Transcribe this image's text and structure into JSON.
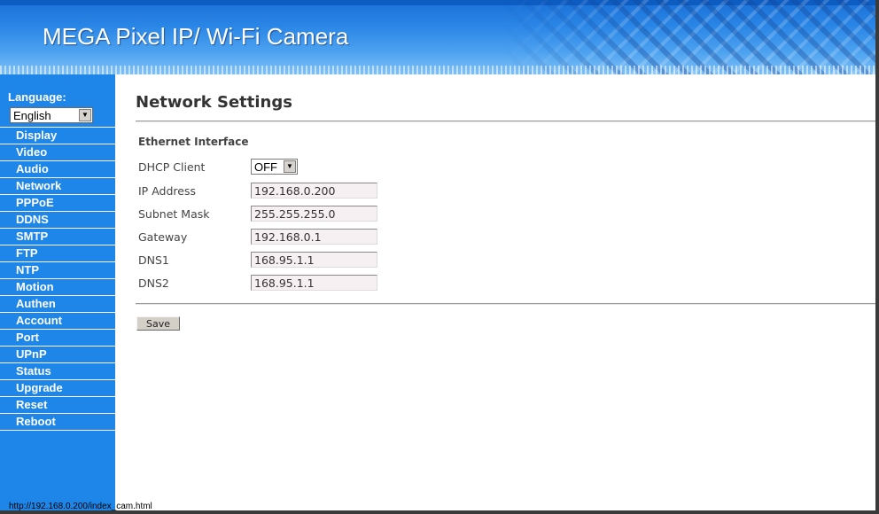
{
  "header": {
    "title": "MEGA Pixel IP/ Wi-Fi Camera"
  },
  "sidebar": {
    "language_label": "Language:",
    "language_value": "English",
    "menu": [
      {
        "label": "Display"
      },
      {
        "label": "Video"
      },
      {
        "label": "Audio"
      },
      {
        "label": "Network"
      },
      {
        "label": "PPPoE"
      },
      {
        "label": "DDNS"
      },
      {
        "label": "SMTP"
      },
      {
        "label": "FTP"
      },
      {
        "label": "NTP"
      },
      {
        "label": "Motion"
      },
      {
        "label": "Authen"
      },
      {
        "label": "Account"
      },
      {
        "label": "Port"
      },
      {
        "label": "UPnP"
      },
      {
        "label": "Status"
      },
      {
        "label": "Upgrade"
      },
      {
        "label": "Reset"
      },
      {
        "label": "Reboot"
      }
    ]
  },
  "main": {
    "page_title": "Network Settings",
    "section_title": "Ethernet Interface",
    "dhcp": {
      "label": "DHCP Client",
      "value": "OFF"
    },
    "fields": [
      {
        "label": "IP Address",
        "value": "192.168.0.200"
      },
      {
        "label": "Subnet Mask",
        "value": "255.255.255.0"
      },
      {
        "label": "Gateway",
        "value": "192.168.0.1"
      },
      {
        "label": "DNS1",
        "value": "168.95.1.1"
      },
      {
        "label": "DNS2",
        "value": "168.95.1.1"
      }
    ],
    "save_label": "Save"
  },
  "status_bar": {
    "url": "http://192.168.0.200/index_cam.html"
  },
  "colors": {
    "sidebar": "#1e86e8",
    "header": "#2a86e6",
    "title_text": "#333333"
  },
  "icons": {
    "dropdown": "chevron-down-icon"
  }
}
